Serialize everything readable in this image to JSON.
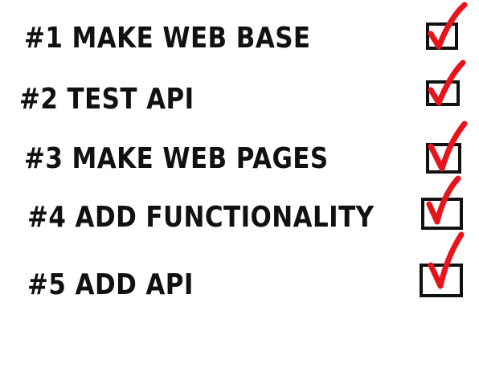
{
  "tasks": [
    {
      "label": "#1 MAKE WEB BASE",
      "checked": true
    },
    {
      "label": "#2 TEST API",
      "checked": true
    },
    {
      "label": "#3 MAKE WEB PAGES",
      "checked": true
    },
    {
      "label": "#4 ADD FUNCTIONALITY",
      "checked": true
    },
    {
      "label": "#5 ADD API",
      "checked": true
    }
  ],
  "colors": {
    "text": "#111111",
    "box_border": "#111111",
    "check_mark": "#e8141c"
  },
  "icons": {
    "check": "check-mark-icon"
  }
}
